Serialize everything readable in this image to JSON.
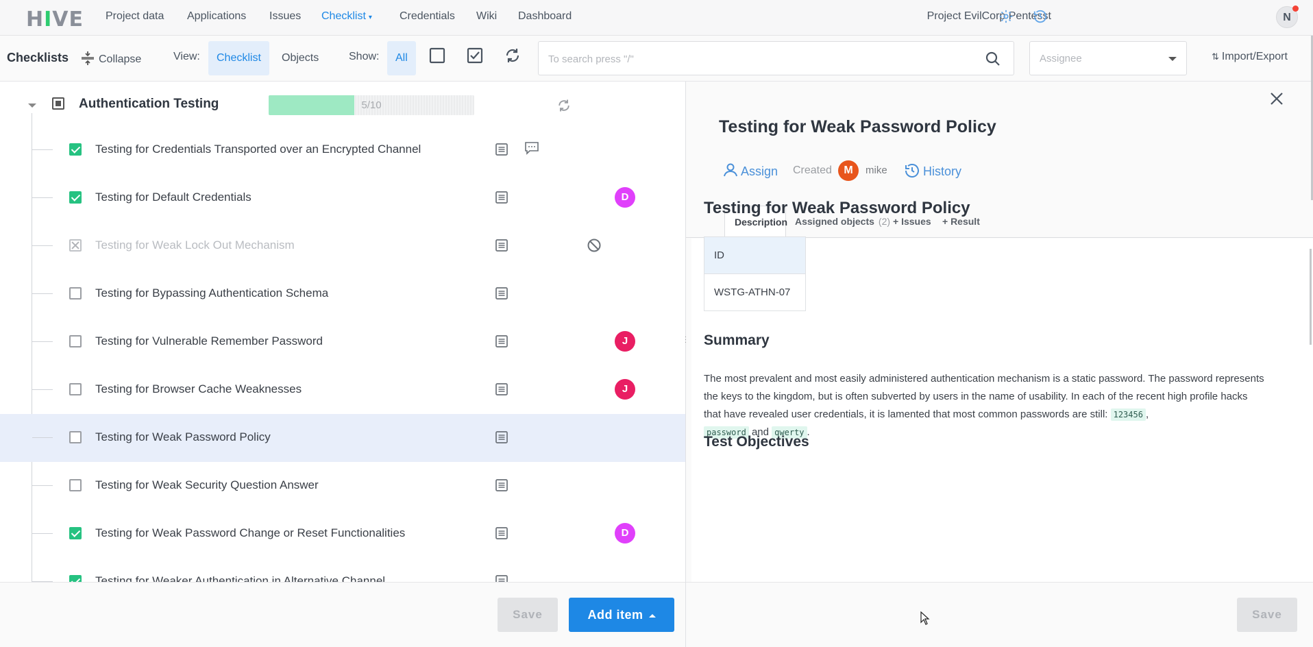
{
  "topnav": {
    "logo": "HIVE",
    "links": [
      {
        "label": "Project data"
      },
      {
        "label": "Applications"
      },
      {
        "label": "Issues"
      },
      {
        "label": "Checklist"
      },
      {
        "label": "Credentials"
      },
      {
        "label": "Wiki"
      },
      {
        "label": "Dashboard"
      }
    ],
    "active_link": "Checklist",
    "project_name": "Project EvilCorp Pentesst",
    "user_initial": "N",
    "icons": [
      "gear-icon",
      "history-icon"
    ]
  },
  "toolbar": {
    "title": "Checklists",
    "collapse_label": "Collapse",
    "view_label": "View:",
    "view_options": [
      "Checklist",
      "Objects"
    ],
    "view_selected": "Checklist",
    "show_label": "Show:",
    "show_all_label": "All",
    "search_placeholder": "To search press \"/\"",
    "assignee_placeholder": "Assignee",
    "import_export_label": "Import/Export"
  },
  "checklist": {
    "group": {
      "title": "Authentication Testing",
      "progress_done": 5,
      "progress_total": 10,
      "progress_label": "5/10"
    },
    "items": [
      {
        "title": "Testing for Credentials Transported over an Encrypted Channel",
        "state": "checked",
        "comment": true,
        "avatar": null
      },
      {
        "title": "Testing for Default Credentials",
        "state": "checked",
        "comment": false,
        "avatar": "D"
      },
      {
        "title": "Testing for Weak Lock Out Mechanism",
        "state": "na",
        "comment": false,
        "avatar": null
      },
      {
        "title": "Testing for Bypassing Authentication Schema",
        "state": "unchecked",
        "comment": false,
        "avatar": null
      },
      {
        "title": "Testing for Vulnerable Remember Password",
        "state": "unchecked",
        "comment": false,
        "avatar": "J"
      },
      {
        "title": "Testing for Browser Cache Weaknesses",
        "state": "unchecked",
        "comment": false,
        "avatar": "J"
      },
      {
        "title": "Testing for Weak Password Policy",
        "state": "unchecked",
        "comment": false,
        "avatar": null,
        "selected": true
      },
      {
        "title": "Testing for Weak Security Question Answer",
        "state": "unchecked",
        "comment": false,
        "avatar": null
      },
      {
        "title": "Testing for Weak Password Change or Reset Functionalities",
        "state": "checked",
        "comment": false,
        "avatar": "D"
      },
      {
        "title": "Testing for Weaker Authentication in Alternative Channel",
        "state": "checked",
        "comment": false,
        "avatar": null
      }
    ],
    "avatar_colors": {
      "D": "#e040fb",
      "J": "#e91e63"
    }
  },
  "left_footer": {
    "save_label": "Save",
    "add_item_label": "Add item"
  },
  "detail": {
    "title": "Testing for Weak Password Policy",
    "assign_label": "Assign",
    "created_label": "Created",
    "creator_initial": "M",
    "creator_name": "mike",
    "history_label": "History",
    "tabs": [
      {
        "label": "Description"
      },
      {
        "label": "Assigned objects",
        "count": "(2)"
      },
      {
        "label": "+ Issues"
      },
      {
        "label": "+ Result"
      }
    ],
    "active_tab": "Description",
    "content": {
      "heading": "Testing for Weak Password Policy",
      "table_header": "ID",
      "table_value": "WSTG-ATHN-07",
      "summary_heading": "Summary",
      "summary_text_1": "The most prevalent and most easily administered authentication mechanism is a static password. The password represents the keys to the kingdom, but is often subverted by users in the name of usability. In each of the recent high profile hacks that have revealed user credentials, it is lamented that most common passwords are still: ",
      "code_1": "123456",
      "summary_text_2": ",",
      "code_2": "password",
      "summary_text_3": " and ",
      "code_3": "qwerty",
      "summary_text_4": ".",
      "objectives_heading": "Test Objectives"
    },
    "save_label": "Save"
  }
}
